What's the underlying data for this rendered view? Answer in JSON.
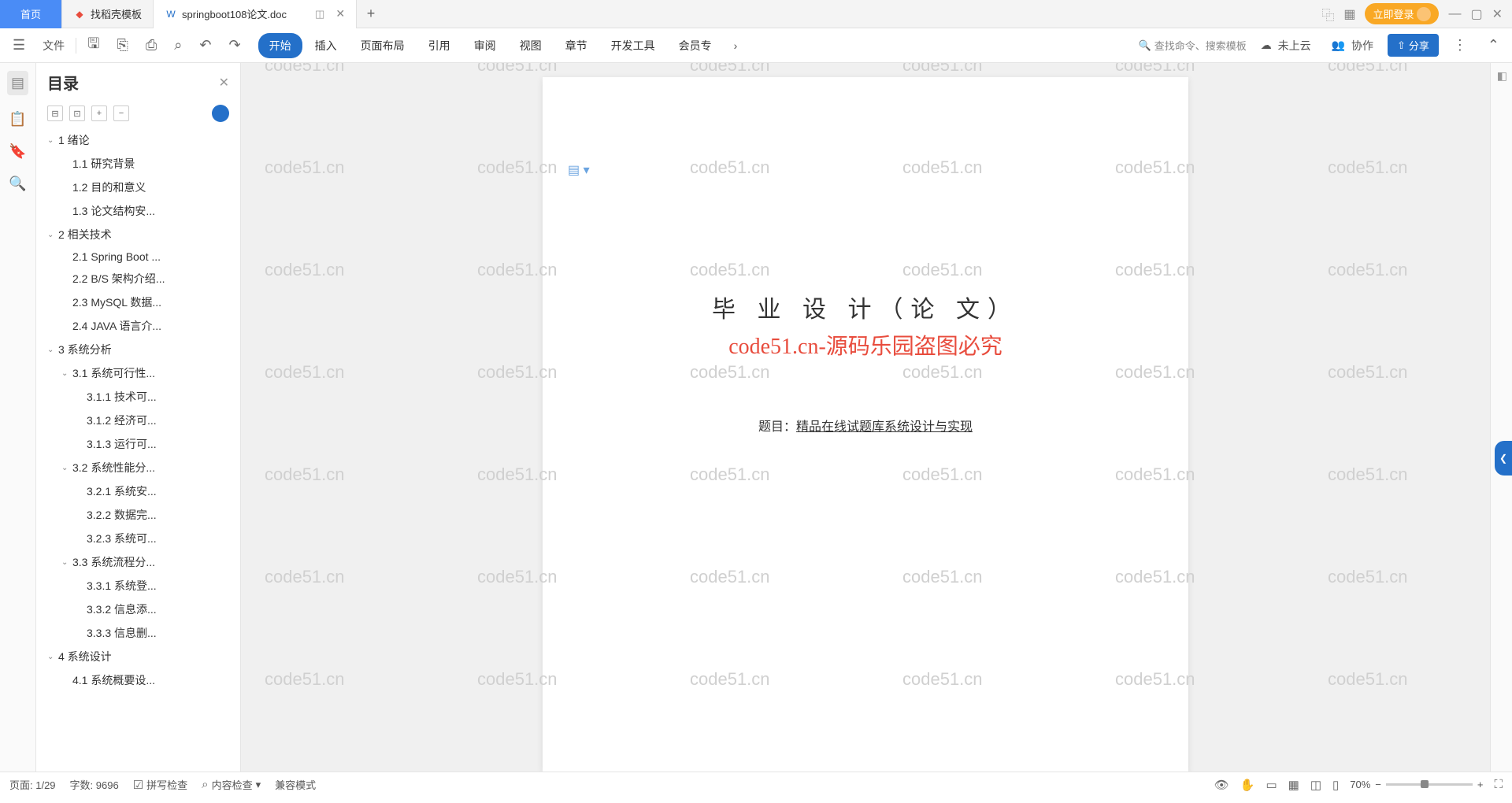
{
  "tabs": {
    "home": "首页",
    "t1": "找稻壳模板",
    "t2": "springboot108论文.doc"
  },
  "login": "立即登录",
  "file_menu": "文件",
  "ribbon": [
    "开始",
    "插入",
    "页面布局",
    "引用",
    "审阅",
    "视图",
    "章节",
    "开发工具",
    "会员专"
  ],
  "search_ph": "查找命令、搜索模板",
  "cloud": "未上云",
  "collab": "协作",
  "share": "分享",
  "outline_title": "目录",
  "tree": [
    {
      "l": 0,
      "c": 1,
      "t": "1  绪论"
    },
    {
      "l": 1,
      "c": 0,
      "t": "1.1 研究背景"
    },
    {
      "l": 1,
      "c": 0,
      "t": "1.2 目的和意义"
    },
    {
      "l": 1,
      "c": 0,
      "t": "1.3 论文结构安..."
    },
    {
      "l": 0,
      "c": 1,
      "t": "2  相关技术"
    },
    {
      "l": 1,
      "c": 0,
      "t": "2.1 Spring Boot ..."
    },
    {
      "l": 1,
      "c": 0,
      "t": "2.2 B/S 架构介绍..."
    },
    {
      "l": 1,
      "c": 0,
      "t": "2.3 MySQL 数据..."
    },
    {
      "l": 1,
      "c": 0,
      "t": "2.4 JAVA 语言介..."
    },
    {
      "l": 0,
      "c": 1,
      "t": "3  系统分析"
    },
    {
      "l": 1,
      "c": 1,
      "t": "3.1 系统可行性..."
    },
    {
      "l": 2,
      "c": 0,
      "t": "3.1.1 技术可..."
    },
    {
      "l": 2,
      "c": 0,
      "t": "3.1.2 经济可..."
    },
    {
      "l": 2,
      "c": 0,
      "t": "3.1.3 运行可..."
    },
    {
      "l": 1,
      "c": 1,
      "t": "3.2 系统性能分..."
    },
    {
      "l": 2,
      "c": 0,
      "t": "3.2.1 系统安..."
    },
    {
      "l": 2,
      "c": 0,
      "t": "3.2.2 数据完..."
    },
    {
      "l": 2,
      "c": 0,
      "t": "3.2.3 系统可..."
    },
    {
      "l": 1,
      "c": 1,
      "t": "3.3 系统流程分..."
    },
    {
      "l": 2,
      "c": 0,
      "t": "3.3.1 系统登..."
    },
    {
      "l": 2,
      "c": 0,
      "t": "3.3.2 信息添..."
    },
    {
      "l": 2,
      "c": 0,
      "t": "3.3.3 信息删..."
    },
    {
      "l": 0,
      "c": 1,
      "t": "4  系统设计"
    },
    {
      "l": 1,
      "c": 0,
      "t": "4.1 系统概要设..."
    }
  ],
  "doc": {
    "title": "毕 业 设 计（论 文）",
    "watermark_line": "code51.cn-源码乐园盗图必究",
    "subject_label": "题目：",
    "subject_value": "精品在线试题库系统设计与实现"
  },
  "status": {
    "page": "页面: 1/29",
    "words": "字数: 9696",
    "spell": "拼写检查",
    "content": "内容检查",
    "compat": "兼容模式",
    "zoom": "70%"
  },
  "wm_text": "code51.cn"
}
